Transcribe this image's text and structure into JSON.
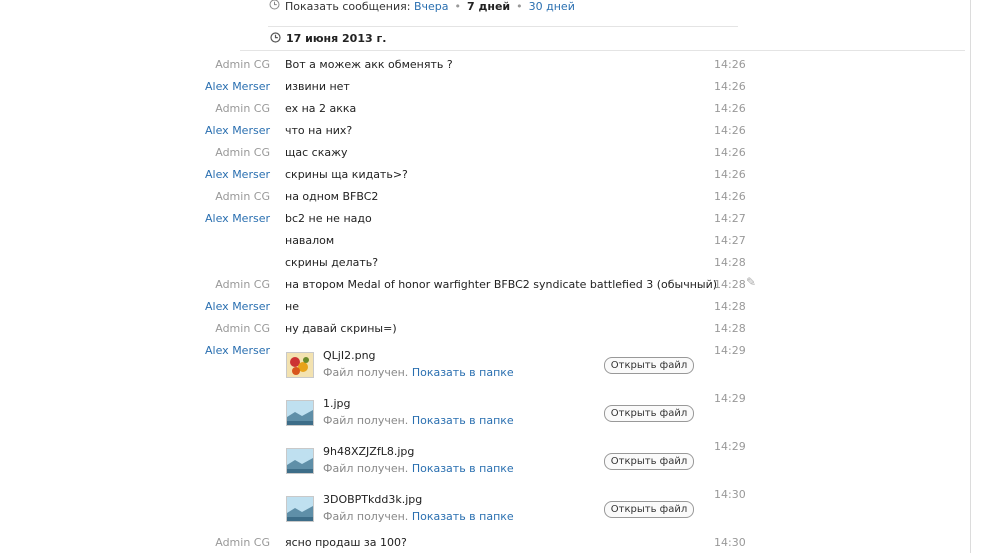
{
  "filter": {
    "label": "Показать сообщения:",
    "option_yesterday": "Вчера",
    "option_7days": "7 дней",
    "option_30days": "30 дней"
  },
  "date_header": "17 июня 2013 г.",
  "icons": {
    "clock": "clock-icon",
    "pencil": "pencil-icon",
    "image_thumb": "image-thumbnail-icon"
  },
  "colors": {
    "link": "#2a6fb0",
    "muted": "#999999",
    "text": "#222222"
  },
  "messages": [
    {
      "sender": "Admin CG",
      "text": "Вот а можеж акк обменять ?",
      "time": "14:26"
    },
    {
      "sender": "Alex Merser",
      "text": "извини нет",
      "time": "14:26"
    },
    {
      "sender": "Admin CG",
      "text": "ex на 2 акка",
      "time": "14:26"
    },
    {
      "sender": "Alex Merser",
      "text": "что на них?",
      "time": "14:26"
    },
    {
      "sender": "Admin CG",
      "text": "щас скажу",
      "time": "14:26"
    },
    {
      "sender": "Alex Merser",
      "text": "скрины ща кидать>?",
      "time": "14:26"
    },
    {
      "sender": "Admin CG",
      "text": "на одном BFBC2",
      "time": "14:26"
    },
    {
      "sender": "Alex Merser",
      "text": "bc2 не не надо",
      "time": "14:27"
    },
    {
      "sender": "",
      "text": "навалом",
      "time": "14:27"
    },
    {
      "sender": "",
      "text": "скрины делать?",
      "time": "14:28"
    },
    {
      "sender": "Admin CG",
      "text": "на втором Medal of honor warfighter BFBC2 syndicate battlefied 3 (обычный)",
      "time": "14:28"
    },
    {
      "sender": "Alex Merser",
      "text": "не",
      "time": "14:28"
    },
    {
      "sender": "Admin CG",
      "text": "ну давай скрины=)",
      "time": "14:28"
    }
  ],
  "file_sender": "Alex Merser",
  "files": [
    {
      "name": "QLjI2.png",
      "status": "Файл получен.",
      "show_link": "Показать в папке",
      "open_label": "Открыть файл",
      "time": "14:29"
    },
    {
      "name": "1.jpg",
      "status": "Файл получен.",
      "show_link": "Показать в папке",
      "open_label": "Открыть файл",
      "time": "14:29"
    },
    {
      "name": "9h48XZJZfL8.jpg",
      "status": "Файл получен.",
      "show_link": "Показать в папке",
      "open_label": "Открыть файл",
      "time": "14:29"
    },
    {
      "name": "3DOBPTkdd3k.jpg",
      "status": "Файл получен.",
      "show_link": "Показать в папке",
      "open_label": "Открыть файл",
      "time": "14:30"
    }
  ],
  "last_message": {
    "sender": "Admin CG",
    "text": "ясно продаш за 100?",
    "time": "14:30"
  }
}
